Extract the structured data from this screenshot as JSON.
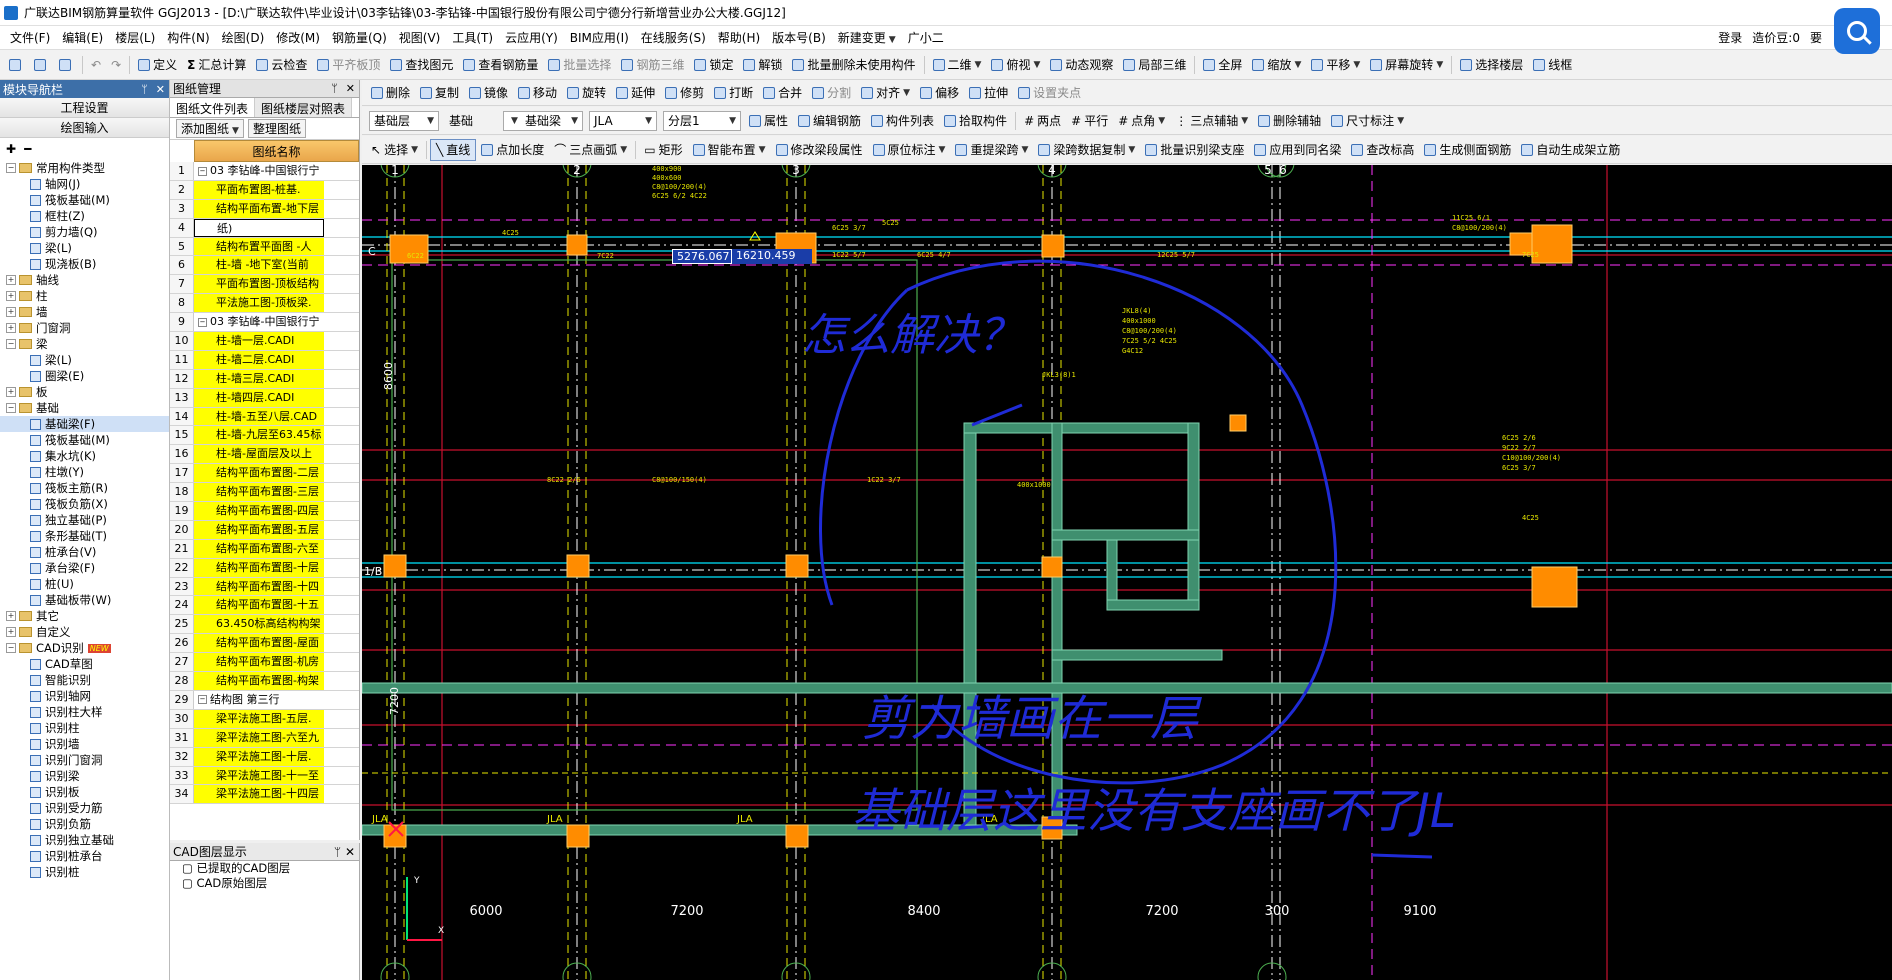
{
  "window": {
    "title": "广联达BIM钢筋算量软件 GGJ2013 - [D:\\广联达软件\\毕业设计\\03李钻锋\\03-李钻锋-中国银行股份有限公司宁德分行新增营业办公大楼.GGJ12]"
  },
  "menu": {
    "items": [
      "文件(F)",
      "编辑(E)",
      "楼层(L)",
      "构件(N)",
      "绘图(D)",
      "修改(M)",
      "钢筋量(Q)",
      "视图(V)",
      "工具(T)",
      "云应用(Y)",
      "BIM应用(I)",
      "在线服务(S)",
      "帮助(H)",
      "版本号(B)",
      "新建变更",
      "广小二"
    ],
    "login": "登录",
    "price": "造价豆:0",
    "cut": "要"
  },
  "toolbar1": {
    "items": [
      "定义",
      "汇总计算",
      "云检查",
      "平齐板顶",
      "查找图元",
      "查看钢筋量",
      "批量选择",
      "钢筋三维",
      "锁定",
      "解锁",
      "批量删除未使用构件",
      "二维",
      "俯视",
      "动态观察",
      "局部三维",
      "全屏",
      "缩放",
      "平移",
      "屏幕旋转",
      "选择楼层",
      "线框"
    ]
  },
  "toolbar2": {
    "items": [
      "删除",
      "复制",
      "镜像",
      "移动",
      "旋转",
      "延伸",
      "修剪",
      "打断",
      "合并",
      "分割",
      "对齐",
      "偏移",
      "拉伸",
      "设置夹点"
    ]
  },
  "toolbar3": {
    "floor": "基础层",
    "category": "基础",
    "type": "基础梁",
    "component": "JLA",
    "layer": "分层1",
    "items": [
      "属性",
      "编辑钢筋",
      "构件列表",
      "拾取构件",
      "两点",
      "平行",
      "点角",
      "三点辅轴",
      "删除辅轴",
      "尺寸标注"
    ]
  },
  "toolbar4": {
    "items": [
      "选择",
      "直线",
      "点加长度",
      "三点画弧",
      "矩形",
      "智能布置",
      "修改梁段属性",
      "原位标注",
      "重提梁跨",
      "梁跨数据复制",
      "批量识别梁支座",
      "应用到同名梁",
      "查改标高",
      "生成侧面钢筋",
      "自动生成架立筋"
    ]
  },
  "nav": {
    "title": "模块导航栏",
    "btn_project": "工程设置",
    "btn_draw": "绘图输入",
    "tree": [
      {
        "label": "常用构件类型",
        "level": 0,
        "kind": "folder",
        "open": true
      },
      {
        "label": "轴网(J)",
        "level": 1
      },
      {
        "label": "筏板基础(M)",
        "level": 1
      },
      {
        "label": "框柱(Z)",
        "level": 1
      },
      {
        "label": "剪力墙(Q)",
        "level": 1
      },
      {
        "label": "梁(L)",
        "level": 1
      },
      {
        "label": "现浇板(B)",
        "level": 1
      },
      {
        "label": "轴线",
        "level": 0,
        "kind": "folder"
      },
      {
        "label": "柱",
        "level": 0,
        "kind": "folder"
      },
      {
        "label": "墙",
        "level": 0,
        "kind": "folder"
      },
      {
        "label": "门窗洞",
        "level": 0,
        "kind": "folder"
      },
      {
        "label": "梁",
        "level": 0,
        "kind": "folder",
        "open": true
      },
      {
        "label": "梁(L)",
        "level": 1
      },
      {
        "label": "圈梁(E)",
        "level": 1
      },
      {
        "label": "板",
        "level": 0,
        "kind": "folder"
      },
      {
        "label": "基础",
        "level": 0,
        "kind": "folder",
        "open": true
      },
      {
        "label": "基础梁(F)",
        "level": 1,
        "selected": true
      },
      {
        "label": "筏板基础(M)",
        "level": 1
      },
      {
        "label": "集水坑(K)",
        "level": 1
      },
      {
        "label": "柱墩(Y)",
        "level": 1
      },
      {
        "label": "筏板主筋(R)",
        "level": 1
      },
      {
        "label": "筏板负筋(X)",
        "level": 1
      },
      {
        "label": "独立基础(P)",
        "level": 1
      },
      {
        "label": "条形基础(T)",
        "level": 1
      },
      {
        "label": "桩承台(V)",
        "level": 1
      },
      {
        "label": "承台梁(F)",
        "level": 1
      },
      {
        "label": "桩(U)",
        "level": 1
      },
      {
        "label": "基础板带(W)",
        "level": 1
      },
      {
        "label": "其它",
        "level": 0,
        "kind": "folder"
      },
      {
        "label": "自定义",
        "level": 0,
        "kind": "folder"
      },
      {
        "label": "CAD识别",
        "level": 0,
        "kind": "folder",
        "open": true,
        "badge": "NEW"
      },
      {
        "label": "CAD草图",
        "level": 1
      },
      {
        "label": "智能识别",
        "level": 1
      },
      {
        "label": "识别轴网",
        "level": 1
      },
      {
        "label": "识别柱大样",
        "level": 1
      },
      {
        "label": "识别柱",
        "level": 1
      },
      {
        "label": "识别墙",
        "level": 1
      },
      {
        "label": "识别门窗洞",
        "level": 1
      },
      {
        "label": "识别梁",
        "level": 1
      },
      {
        "label": "识别板",
        "level": 1
      },
      {
        "label": "识别受力筋",
        "level": 1
      },
      {
        "label": "识别负筋",
        "level": 1
      },
      {
        "label": "识别独立基础",
        "level": 1
      },
      {
        "label": "识别桩承台",
        "level": 1
      },
      {
        "label": "识别桩",
        "level": 1
      }
    ]
  },
  "drawing_panel": {
    "title": "图纸管理",
    "tab_files": "图纸文件列表",
    "tab_floors": "图纸楼层对照表",
    "btn_add": "添加图纸",
    "btn_organize": "整理图纸",
    "column": "图纸名称",
    "rows": [
      {
        "n": "1",
        "name": "03 李钻峰-中国银行宁",
        "group": true
      },
      {
        "n": "2",
        "name": "平面布置图-桩基."
      },
      {
        "n": "3",
        "name": "结构平面布置-地下层"
      },
      {
        "n": "4",
        "name": "纸)",
        "selected": true
      },
      {
        "n": "5",
        "name": "结构布置平面图 -人"
      },
      {
        "n": "6",
        "name": "柱-墙 -地下室(当前"
      },
      {
        "n": "7",
        "name": "平面布置图-顶板结构"
      },
      {
        "n": "8",
        "name": "平法施工图-顶板梁."
      },
      {
        "n": "9",
        "name": "03 李钻峰-中国银行宁",
        "group": true
      },
      {
        "n": "10",
        "name": "柱-墙一层.CADI"
      },
      {
        "n": "11",
        "name": "柱-墙二层.CADI"
      },
      {
        "n": "12",
        "name": "柱-墙三层.CADI"
      },
      {
        "n": "13",
        "name": "柱-墙四层.CADI"
      },
      {
        "n": "14",
        "name": "柱-墙-五至八层.CAD"
      },
      {
        "n": "15",
        "name": "柱-墙-九层至63.45标"
      },
      {
        "n": "16",
        "name": "柱-墙-屋面层及以上"
      },
      {
        "n": "17",
        "name": "结构平面布置图-二层"
      },
      {
        "n": "18",
        "name": "结构平面布置图-三层"
      },
      {
        "n": "19",
        "name": "结构平面布置图-四层"
      },
      {
        "n": "20",
        "name": "结构平面布置图-五层"
      },
      {
        "n": "21",
        "name": "结构平面布置图-六至"
      },
      {
        "n": "22",
        "name": "结构平面布置图-十层"
      },
      {
        "n": "23",
        "name": "结构平面布置图-十四"
      },
      {
        "n": "24",
        "name": "结构平面布置图-十五"
      },
      {
        "n": "25",
        "name": "63.450标高结构构架"
      },
      {
        "n": "26",
        "name": "结构平面布置图-屋面"
      },
      {
        "n": "27",
        "name": "结构平面布置图-机房"
      },
      {
        "n": "28",
        "name": "结构平面布置图-构架"
      },
      {
        "n": "29",
        "name": "结构图   第三行",
        "group": true
      },
      {
        "n": "30",
        "name": "梁平法施工图-五层."
      },
      {
        "n": "31",
        "name": "梁平法施工图-六至九"
      },
      {
        "n": "32",
        "name": "梁平法施工图-十层."
      },
      {
        "n": "33",
        "name": "梁平法施工图-十一至"
      },
      {
        "n": "34",
        "name": "梁平法施工图-十四层"
      }
    ]
  },
  "cad_layers": {
    "title": "CAD图层显示",
    "items": [
      "已提取的CAD图层",
      "CAD原始图层"
    ]
  },
  "canvas": {
    "coord_x": "5276.067",
    "coord_y": "16210.459",
    "axis_top": [
      "1",
      "2",
      "3",
      "4",
      "5",
      "6"
    ],
    "axis_bottom": [
      "1",
      "2",
      "3",
      "4",
      "5",
      "6"
    ],
    "axis_left": [
      "C",
      "1/B"
    ],
    "dims_bottom": [
      "6000",
      "7200",
      "8400",
      "7200",
      "300",
      "9100"
    ],
    "dims_left": [
      "8600",
      "7200"
    ],
    "beam_labels": [
      "JLA",
      "JLA",
      "JLA",
      "JLA"
    ],
    "handwriting": [
      "怎么解决？",
      "剪力墙画在一层",
      "基础层这里没有支座画不了JL"
    ],
    "annotations": [
      "4C25",
      "6C22",
      "7C22",
      "1C22 5/7",
      "12C25 5/7",
      "6C25 3/7",
      "5C25",
      "400x900",
      "400x600",
      "C8@100/200(4)",
      "6C25 6/2 4C22",
      "8C22 2/6",
      "C8@100/150(4)",
      "1C22 3/7",
      "400x1000",
      "11C25 6/1",
      "C8@100/200(4)",
      "7C25",
      "JKL3(8)1",
      "JKL8(4)",
      "400x1000",
      "C8@100/200(4)",
      "7C25 5/2 4C25",
      "G4C12",
      "6C25 2/6",
      "9C22 2/7",
      "C10@100/200(4)",
      "6C25 3/7",
      "4C25",
      "6C25 4/7"
    ]
  }
}
